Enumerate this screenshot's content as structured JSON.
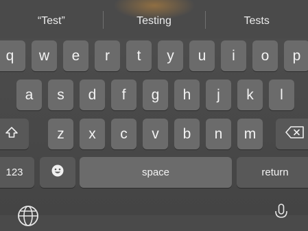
{
  "suggestions": [
    "“Test”",
    "Testing",
    "Tests"
  ],
  "rows": {
    "row1": [
      "q",
      "w",
      "e",
      "r",
      "t",
      "y",
      "u",
      "i",
      "o",
      "p"
    ],
    "row2": [
      "a",
      "s",
      "d",
      "f",
      "g",
      "h",
      "j",
      "k",
      "l"
    ],
    "row3": [
      "z",
      "x",
      "c",
      "v",
      "b",
      "n",
      "m"
    ]
  },
  "keys": {
    "numbers_label": "123",
    "space_label": "space",
    "return_label": "return"
  },
  "icons": {
    "shift": "shift-icon",
    "delete": "delete-icon",
    "emoji": "emoji-icon",
    "globe": "globe-icon",
    "mic": "microphone-icon"
  }
}
